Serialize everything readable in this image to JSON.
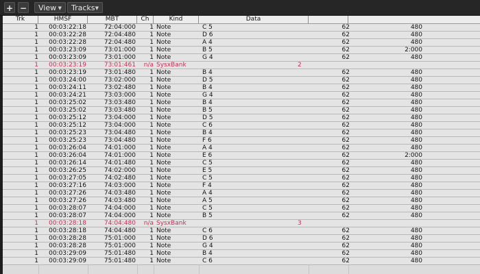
{
  "toolbar": {
    "add_label": "+",
    "remove_label": "−",
    "view_label": "View",
    "tracks_label": "Tracks"
  },
  "columns": {
    "trk": "Trk",
    "hmsf": "HMSF",
    "mbt": "MBT",
    "ch": "Ch",
    "kind": "Kind",
    "data": "Data"
  },
  "colors": {
    "sysx_text": "#d02a52",
    "row_bg": "#e4e4e4",
    "header_bg": "#ececec"
  },
  "events": [
    {
      "trk": "1",
      "hmsf": "00:03:22:18",
      "mbt": "72:04:000",
      "ch": "1",
      "kind": "Note",
      "note": "C 5",
      "vel": "62",
      "len": "480"
    },
    {
      "trk": "1",
      "hmsf": "00:03:22:28",
      "mbt": "72:04:480",
      "ch": "1",
      "kind": "Note",
      "note": "D 6",
      "vel": "62",
      "len": "480"
    },
    {
      "trk": "1",
      "hmsf": "00:03:22:28",
      "mbt": "72:04:480",
      "ch": "1",
      "kind": "Note",
      "note": "A 4",
      "vel": "62",
      "len": "480"
    },
    {
      "trk": "1",
      "hmsf": "00:03:23:09",
      "mbt": "73:01:000",
      "ch": "1",
      "kind": "Note",
      "note": "B 5",
      "vel": "62",
      "len": "2:000"
    },
    {
      "trk": "1",
      "hmsf": "00:03:23:09",
      "mbt": "73:01:000",
      "ch": "1",
      "kind": "Note",
      "note": "G 4",
      "vel": "62",
      "len": "480"
    },
    {
      "trk": "1",
      "hmsf": "00:03:23:19",
      "mbt": "73:01:461",
      "ch": "n/a",
      "kind": "SysxBank",
      "sysx": "2",
      "type": "sysx"
    },
    {
      "trk": "1",
      "hmsf": "00:03:23:19",
      "mbt": "73:01:480",
      "ch": "1",
      "kind": "Note",
      "note": "B 4",
      "vel": "62",
      "len": "480"
    },
    {
      "trk": "1",
      "hmsf": "00:03:24:00",
      "mbt": "73:02:000",
      "ch": "1",
      "kind": "Note",
      "note": "D 5",
      "vel": "62",
      "len": "480"
    },
    {
      "trk": "1",
      "hmsf": "00:03:24:11",
      "mbt": "73:02:480",
      "ch": "1",
      "kind": "Note",
      "note": "B 4",
      "vel": "62",
      "len": "480"
    },
    {
      "trk": "1",
      "hmsf": "00:03:24:21",
      "mbt": "73:03:000",
      "ch": "1",
      "kind": "Note",
      "note": "G 4",
      "vel": "62",
      "len": "480"
    },
    {
      "trk": "1",
      "hmsf": "00:03:25:02",
      "mbt": "73:03:480",
      "ch": "1",
      "kind": "Note",
      "note": "B 4",
      "vel": "62",
      "len": "480"
    },
    {
      "trk": "1",
      "hmsf": "00:03:25:02",
      "mbt": "73:03:480",
      "ch": "1",
      "kind": "Note",
      "note": "B 5",
      "vel": "62",
      "len": "480"
    },
    {
      "trk": "1",
      "hmsf": "00:03:25:12",
      "mbt": "73:04:000",
      "ch": "1",
      "kind": "Note",
      "note": "D 5",
      "vel": "62",
      "len": "480"
    },
    {
      "trk": "1",
      "hmsf": "00:03:25:12",
      "mbt": "73:04:000",
      "ch": "1",
      "kind": "Note",
      "note": "C 6",
      "vel": "62",
      "len": "480"
    },
    {
      "trk": "1",
      "hmsf": "00:03:25:23",
      "mbt": "73:04:480",
      "ch": "1",
      "kind": "Note",
      "note": "B 4",
      "vel": "62",
      "len": "480"
    },
    {
      "trk": "1",
      "hmsf": "00:03:25:23",
      "mbt": "73:04:480",
      "ch": "1",
      "kind": "Note",
      "note": "F 6",
      "vel": "62",
      "len": "480"
    },
    {
      "trk": "1",
      "hmsf": "00:03:26:04",
      "mbt": "74:01:000",
      "ch": "1",
      "kind": "Note",
      "note": "A 4",
      "vel": "62",
      "len": "480"
    },
    {
      "trk": "1",
      "hmsf": "00:03:26:04",
      "mbt": "74:01:000",
      "ch": "1",
      "kind": "Note",
      "note": "E 6",
      "vel": "62",
      "len": "2:000"
    },
    {
      "trk": "1",
      "hmsf": "00:03:26:14",
      "mbt": "74:01:480",
      "ch": "1",
      "kind": "Note",
      "note": "C 5",
      "vel": "62",
      "len": "480"
    },
    {
      "trk": "1",
      "hmsf": "00:03:26:25",
      "mbt": "74:02:000",
      "ch": "1",
      "kind": "Note",
      "note": "E 5",
      "vel": "62",
      "len": "480"
    },
    {
      "trk": "1",
      "hmsf": "00:03:27:05",
      "mbt": "74:02:480",
      "ch": "1",
      "kind": "Note",
      "note": "C 5",
      "vel": "62",
      "len": "480"
    },
    {
      "trk": "1",
      "hmsf": "00:03:27:16",
      "mbt": "74:03:000",
      "ch": "1",
      "kind": "Note",
      "note": "F 4",
      "vel": "62",
      "len": "480"
    },
    {
      "trk": "1",
      "hmsf": "00:03:27:26",
      "mbt": "74:03:480",
      "ch": "1",
      "kind": "Note",
      "note": "A 4",
      "vel": "62",
      "len": "480"
    },
    {
      "trk": "1",
      "hmsf": "00:03:27:26",
      "mbt": "74:03:480",
      "ch": "1",
      "kind": "Note",
      "note": "A 5",
      "vel": "62",
      "len": "480"
    },
    {
      "trk": "1",
      "hmsf": "00:03:28:07",
      "mbt": "74:04:000",
      "ch": "1",
      "kind": "Note",
      "note": "C 5",
      "vel": "62",
      "len": "480"
    },
    {
      "trk": "1",
      "hmsf": "00:03:28:07",
      "mbt": "74:04:000",
      "ch": "1",
      "kind": "Note",
      "note": "B 5",
      "vel": "62",
      "len": "480"
    },
    {
      "trk": "1",
      "hmsf": "00:03:28:18",
      "mbt": "74:04:480",
      "ch": "n/a",
      "kind": "SysxBank",
      "sysx": "3",
      "type": "sysx"
    },
    {
      "trk": "1",
      "hmsf": "00:03:28:18",
      "mbt": "74:04:480",
      "ch": "1",
      "kind": "Note",
      "note": "C 6",
      "vel": "62",
      "len": "480"
    },
    {
      "trk": "1",
      "hmsf": "00:03:28:28",
      "mbt": "75:01:000",
      "ch": "1",
      "kind": "Note",
      "note": "D 6",
      "vel": "62",
      "len": "480"
    },
    {
      "trk": "1",
      "hmsf": "00:03:28:28",
      "mbt": "75:01:000",
      "ch": "1",
      "kind": "Note",
      "note": "G 4",
      "vel": "62",
      "len": "480"
    },
    {
      "trk": "1",
      "hmsf": "00:03:29:09",
      "mbt": "75:01:480",
      "ch": "1",
      "kind": "Note",
      "note": "B 4",
      "vel": "62",
      "len": "480"
    },
    {
      "trk": "1",
      "hmsf": "00:03:29:09",
      "mbt": "75:01:480",
      "ch": "1",
      "kind": "Note",
      "note": "C 6",
      "vel": "62",
      "len": "480"
    }
  ]
}
